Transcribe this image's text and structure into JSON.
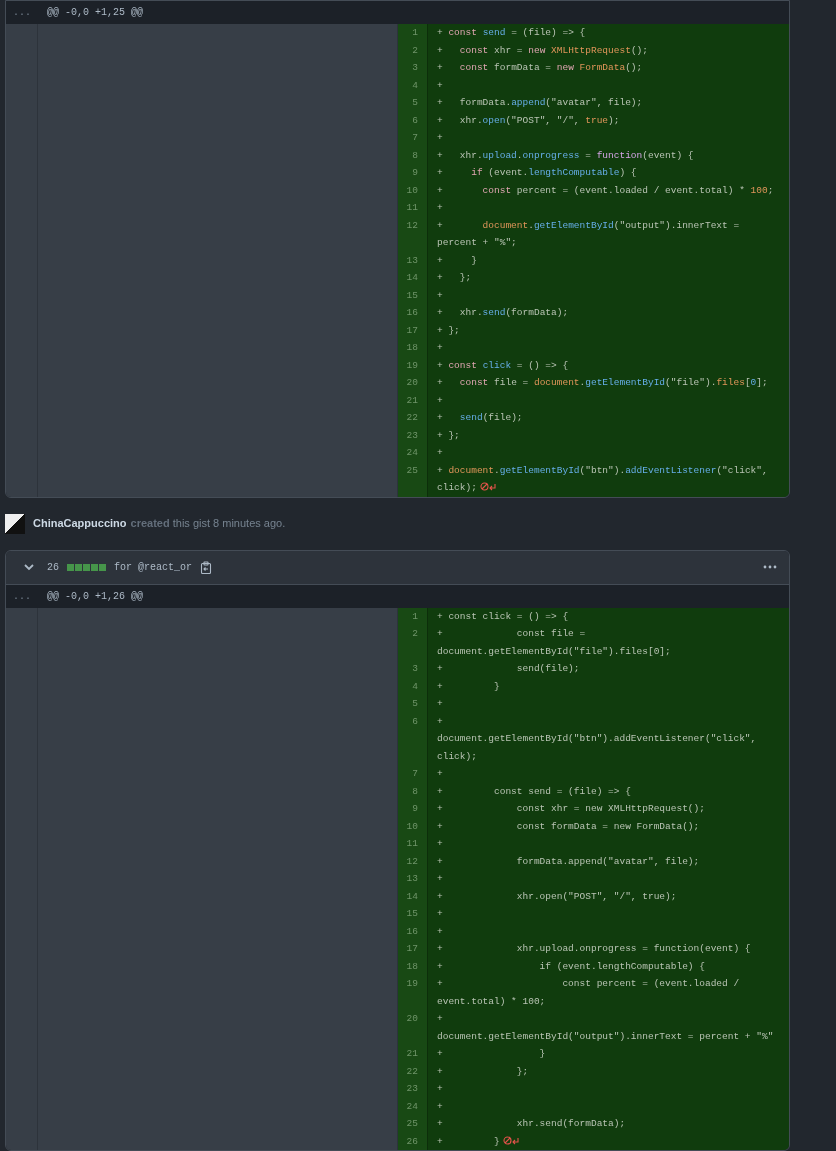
{
  "sections": [
    {
      "kind": "file",
      "hunk": {
        "expand_label": "...",
        "text": "@@ -0,0 +1,25 @@"
      },
      "no_newline_at_end": true,
      "lines": [
        {
          "number": "1",
          "segments": [
            {
              "kind": "plain",
              "text": "+ "
            },
            {
              "kind": "keyword",
              "text": "const "
            },
            {
              "kind": "function",
              "text": "send"
            },
            {
              "kind": "plain",
              "text": " = (file) => {"
            }
          ]
        },
        {
          "number": "2",
          "segments": [
            {
              "kind": "plain",
              "text": "+   "
            },
            {
              "kind": "keyword",
              "text": "const"
            },
            {
              "kind": "plain",
              "text": " xhr = "
            },
            {
              "kind": "keyword",
              "text": "new "
            },
            {
              "kind": "entity",
              "text": "XMLHttpRequest"
            },
            {
              "kind": "plain",
              "text": "();"
            }
          ]
        },
        {
          "number": "3",
          "segments": [
            {
              "kind": "plain",
              "text": "+   "
            },
            {
              "kind": "keyword",
              "text": "const"
            },
            {
              "kind": "plain",
              "text": " formData = "
            },
            {
              "kind": "keyword",
              "text": "new "
            },
            {
              "kind": "entity",
              "text": "FormData"
            },
            {
              "kind": "plain",
              "text": "();"
            }
          ]
        },
        {
          "number": "4",
          "segments": [
            {
              "kind": "plain",
              "text": "+"
            }
          ]
        },
        {
          "number": "5",
          "segments": [
            {
              "kind": "plain",
              "text": "+   formData."
            },
            {
              "kind": "function",
              "text": "append"
            },
            {
              "kind": "plain",
              "text": "(\"avatar\", file);"
            }
          ]
        },
        {
          "number": "6",
          "segments": [
            {
              "kind": "plain",
              "text": "+   xhr."
            },
            {
              "kind": "function",
              "text": "open"
            },
            {
              "kind": "plain",
              "text": "(\"POST\", \"/\", "
            },
            {
              "kind": "entity",
              "text": "true"
            },
            {
              "kind": "plain",
              "text": ");"
            }
          ]
        },
        {
          "number": "7",
          "segments": [
            {
              "kind": "plain",
              "text": "+"
            }
          ]
        },
        {
          "number": "8",
          "segments": [
            {
              "kind": "plain",
              "text": "+   xhr."
            },
            {
              "kind": "function",
              "text": "upload"
            },
            {
              "kind": "plain",
              "text": "."
            },
            {
              "kind": "function",
              "text": "onprogress"
            },
            {
              "kind": "plain",
              "text": " = "
            },
            {
              "kind": "storage",
              "text": "function"
            },
            {
              "kind": "plain",
              "text": "(event) {"
            }
          ]
        },
        {
          "number": "9",
          "segments": [
            {
              "kind": "plain",
              "text": "+     "
            },
            {
              "kind": "keyword",
              "text": "if"
            },
            {
              "kind": "plain",
              "text": " (event."
            },
            {
              "kind": "function",
              "text": "lengthComputable"
            },
            {
              "kind": "plain",
              "text": ") {"
            }
          ]
        },
        {
          "number": "10",
          "segments": [
            {
              "kind": "plain",
              "text": "+       "
            },
            {
              "kind": "keyword",
              "text": "const"
            },
            {
              "kind": "plain",
              "text": " percent = (event.loaded / event.total) * "
            },
            {
              "kind": "entity",
              "text": "100"
            },
            {
              "kind": "plain",
              "text": ";"
            }
          ]
        },
        {
          "number": "11",
          "segments": [
            {
              "kind": "plain",
              "text": "+"
            }
          ]
        },
        {
          "number": "12",
          "segments": [
            {
              "kind": "plain",
              "text": "+       "
            },
            {
              "kind": "entity",
              "text": "document"
            },
            {
              "kind": "plain",
              "text": "."
            },
            {
              "kind": "function",
              "text": "getElementById"
            },
            {
              "kind": "plain",
              "text": "(\"output\").innerText = percent + \"%\";"
            }
          ]
        },
        {
          "number": "13",
          "segments": [
            {
              "kind": "plain",
              "text": "+     }"
            }
          ]
        },
        {
          "number": "14",
          "segments": [
            {
              "kind": "plain",
              "text": "+   };"
            }
          ]
        },
        {
          "number": "15",
          "segments": [
            {
              "kind": "plain",
              "text": "+"
            }
          ]
        },
        {
          "number": "16",
          "segments": [
            {
              "kind": "plain",
              "text": "+   xhr."
            },
            {
              "kind": "function",
              "text": "send"
            },
            {
              "kind": "plain",
              "text": "(formData);"
            }
          ]
        },
        {
          "number": "17",
          "segments": [
            {
              "kind": "plain",
              "text": "+ };"
            }
          ]
        },
        {
          "number": "18",
          "segments": [
            {
              "kind": "plain",
              "text": "+"
            }
          ]
        },
        {
          "number": "19",
          "segments": [
            {
              "kind": "plain",
              "text": "+ "
            },
            {
              "kind": "keyword",
              "text": "const "
            },
            {
              "kind": "function",
              "text": "click"
            },
            {
              "kind": "plain",
              "text": " = () => {"
            }
          ]
        },
        {
          "number": "20",
          "segments": [
            {
              "kind": "plain",
              "text": "+   "
            },
            {
              "kind": "keyword",
              "text": "const"
            },
            {
              "kind": "plain",
              "text": " file = "
            },
            {
              "kind": "entity",
              "text": "document"
            },
            {
              "kind": "plain",
              "text": "."
            },
            {
              "kind": "function",
              "text": "getElementById"
            },
            {
              "kind": "plain",
              "text": "(\"file\")."
            },
            {
              "kind": "entity",
              "text": "files"
            },
            {
              "kind": "plain",
              "text": "["
            },
            {
              "kind": "function",
              "text": "0"
            },
            {
              "kind": "plain",
              "text": "];"
            }
          ]
        },
        {
          "number": "21",
          "segments": [
            {
              "kind": "plain",
              "text": "+"
            }
          ]
        },
        {
          "number": "22",
          "segments": [
            {
              "kind": "plain",
              "text": "+   "
            },
            {
              "kind": "function",
              "text": "send"
            },
            {
              "kind": "plain",
              "text": "(file);"
            }
          ]
        },
        {
          "number": "23",
          "segments": [
            {
              "kind": "plain",
              "text": "+ };"
            }
          ]
        },
        {
          "number": "24",
          "segments": [
            {
              "kind": "plain",
              "text": "+"
            }
          ]
        },
        {
          "number": "25",
          "segments": [
            {
              "kind": "plain",
              "text": "+ "
            },
            {
              "kind": "entity",
              "text": "document"
            },
            {
              "kind": "plain",
              "text": "."
            },
            {
              "kind": "function",
              "text": "getElementById"
            },
            {
              "kind": "plain",
              "text": "(\"btn\")."
            },
            {
              "kind": "function",
              "text": "addEventListener"
            },
            {
              "kind": "plain",
              "text": "(\"click\", click);"
            }
          ]
        }
      ]
    },
    {
      "kind": "activity",
      "author": "ChinaCappuccino",
      "text": "**created** this gist 8 minutes ago."
    },
    {
      "kind": "file",
      "header": {
        "expanded": true,
        "count": "26",
        "diffstat": [
          {
            "kind": "added"
          },
          {
            "kind": "added"
          },
          {
            "kind": "added"
          },
          {
            "kind": "added"
          },
          {
            "kind": "added"
          }
        ],
        "name": "for @react_or"
      },
      "hunk": {
        "expand_label": "...",
        "text": "@@ -0,0 +1,26 @@"
      },
      "no_newline_at_end": true,
      "lines": [
        {
          "number": "1",
          "segments": [
            {
              "kind": "plain",
              "text": "+ const click = () => {"
            }
          ]
        },
        {
          "number": "2",
          "segments": [
            {
              "kind": "plain",
              "text": "+             const file = document.getElementById(\"file\").files[0];"
            }
          ]
        },
        {
          "number": "3",
          "segments": [
            {
              "kind": "plain",
              "text": "+             send(file);"
            }
          ]
        },
        {
          "number": "4",
          "segments": [
            {
              "kind": "plain",
              "text": "+         }"
            }
          ]
        },
        {
          "number": "5",
          "segments": [
            {
              "kind": "plain",
              "text": "+"
            }
          ]
        },
        {
          "number": "6",
          "segments": [
            {
              "kind": "plain",
              "text": "+         document.getElementById(\"btn\").addEventListener(\"click\", click);"
            }
          ]
        },
        {
          "number": "7",
          "segments": [
            {
              "kind": "plain",
              "text": "+"
            }
          ]
        },
        {
          "number": "8",
          "segments": [
            {
              "kind": "plain",
              "text": "+         const send = (file) => {"
            }
          ]
        },
        {
          "number": "9",
          "segments": [
            {
              "kind": "plain",
              "text": "+             const xhr = new XMLHttpRequest();"
            }
          ]
        },
        {
          "number": "10",
          "segments": [
            {
              "kind": "plain",
              "text": "+             const formData = new FormData();"
            }
          ]
        },
        {
          "number": "11",
          "segments": [
            {
              "kind": "plain",
              "text": "+"
            }
          ]
        },
        {
          "number": "12",
          "segments": [
            {
              "kind": "plain",
              "text": "+             formData.append(\"avatar\", file);"
            }
          ]
        },
        {
          "number": "13",
          "segments": [
            {
              "kind": "plain",
              "text": "+"
            }
          ]
        },
        {
          "number": "14",
          "segments": [
            {
              "kind": "plain",
              "text": "+             xhr.open(\"POST\", \"/\", true);"
            }
          ]
        },
        {
          "number": "15",
          "segments": [
            {
              "kind": "plain",
              "text": "+"
            }
          ]
        },
        {
          "number": "16",
          "segments": [
            {
              "kind": "plain",
              "text": "+"
            }
          ]
        },
        {
          "number": "17",
          "segments": [
            {
              "kind": "plain",
              "text": "+             xhr.upload.onprogress = function(event) {"
            }
          ]
        },
        {
          "number": "18",
          "segments": [
            {
              "kind": "plain",
              "text": "+                 if (event.lengthComputable) {"
            }
          ]
        },
        {
          "number": "19",
          "segments": [
            {
              "kind": "plain",
              "text": "+                     const percent = (event.loaded / event.total) * 100;"
            }
          ]
        },
        {
          "number": "20",
          "segments": [
            {
              "kind": "plain",
              "text": "+                 document.getElementById(\"output\").innerText = percent + \"%\""
            }
          ]
        },
        {
          "number": "21",
          "segments": [
            {
              "kind": "plain",
              "text": "+                 }"
            }
          ]
        },
        {
          "number": "22",
          "segments": [
            {
              "kind": "plain",
              "text": "+             };"
            }
          ]
        },
        {
          "number": "23",
          "segments": [
            {
              "kind": "plain",
              "text": "+"
            }
          ]
        },
        {
          "number": "24",
          "segments": [
            {
              "kind": "plain",
              "text": "+"
            }
          ]
        },
        {
          "number": "25",
          "segments": [
            {
              "kind": "plain",
              "text": "+             xhr.send(formData);"
            }
          ]
        },
        {
          "number": "26",
          "segments": [
            {
              "kind": "plain",
              "text": "+         }"
            }
          ]
        }
      ]
    }
  ]
}
